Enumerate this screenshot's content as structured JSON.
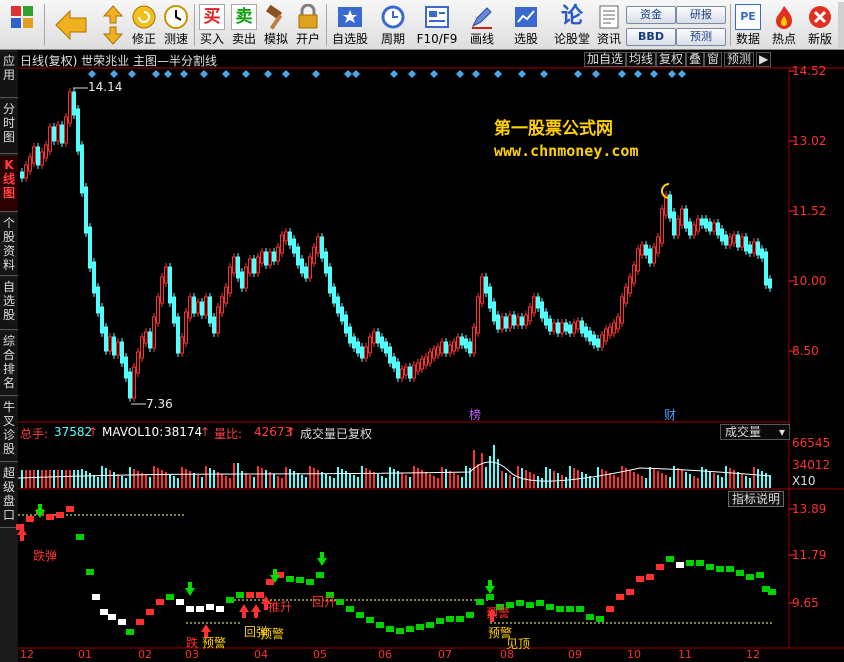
{
  "toolbar": {
    "buttons": [
      {
        "label": "",
        "icon": "grid-icon"
      },
      {
        "label": "",
        "icon": "back-arrow-icon"
      },
      {
        "label": "",
        "icon": "up-down-arrow-icon"
      },
      {
        "label": "修正",
        "icon": "refresh-icon"
      },
      {
        "label": "测速",
        "icon": "clock-icon"
      },
      {
        "label": "买入",
        "icon": "buy-icon",
        "glyph": "买"
      },
      {
        "label": "卖出",
        "icon": "sell-icon",
        "glyph": "卖"
      },
      {
        "label": "模拟",
        "icon": "hammer-icon"
      },
      {
        "label": "开户",
        "icon": "lock-icon"
      },
      {
        "label": "自选股",
        "icon": "star-icon"
      },
      {
        "label": "周期",
        "icon": "cycle-icon"
      },
      {
        "label": "F10/F9",
        "icon": "f10-icon"
      },
      {
        "label": "画线",
        "icon": "pen-icon"
      },
      {
        "label": "选股",
        "icon": "picker-icon"
      },
      {
        "label": "论股堂",
        "icon": "forum-icon",
        "glyph": "论"
      },
      {
        "label": "资讯",
        "icon": "news-icon"
      },
      {
        "label": "数据",
        "icon": "pe-icon",
        "glyph": "PE"
      },
      {
        "label": "热点",
        "icon": "hot-icon"
      },
      {
        "label": "新版",
        "icon": "new-icon"
      },
      {
        "label": "",
        "icon": "more-icon"
      }
    ],
    "pills": [
      "资金",
      "BBD",
      "研报",
      "预测"
    ]
  },
  "side_tabs": [
    "应用",
    "分时图",
    "K线图",
    "个股资料",
    "自选股",
    "综合排名",
    "牛叉诊股",
    "超级盘口"
  ],
  "chart_header": {
    "title": "日线(复权) 世荣兆业 主图—半分割线",
    "buttons": [
      "加自选",
      "均线",
      "复权",
      "叠",
      "窗",
      "预测",
      "▶"
    ]
  },
  "price_axis": [
    "14.52",
    "13.02",
    "11.52",
    "10.00",
    "8.50"
  ],
  "annotations": {
    "high": "14.14",
    "low": "7.36",
    "bang": "榜",
    "cai": "财"
  },
  "watermark": {
    "line1": "第一股票公式网",
    "line2": "www.chnmoney.com"
  },
  "volume_header": {
    "zongshou_label": "总手:",
    "zongshou_value": "37582",
    "mavol_label": "MAVOL10:",
    "mavol_value": "38174",
    "liangbi_label": "量比:",
    "liangbi_value": "42673",
    "note": "成交量已复权",
    "dropdown": "成交量"
  },
  "volume_axis": [
    "66545",
    "34012",
    "X10"
  ],
  "indicator": {
    "help_button": "指标说明",
    "axis": [
      "13.89",
      "11.79",
      "9.65"
    ],
    "labels": [
      "跌弹",
      "跌",
      "预警",
      "回弹",
      "推升",
      "预警",
      "预警",
      "回升",
      "预警",
      "预警",
      "见顶"
    ]
  },
  "x_axis": [
    "12",
    "01",
    "02",
    "03",
    "04",
    "05",
    "06",
    "07",
    "08",
    "09",
    "10",
    "11",
    "12"
  ],
  "colors": {
    "up": "#ff3030",
    "down": "#54ffff",
    "gold": "#ffd000",
    "green": "#00d000"
  }
}
